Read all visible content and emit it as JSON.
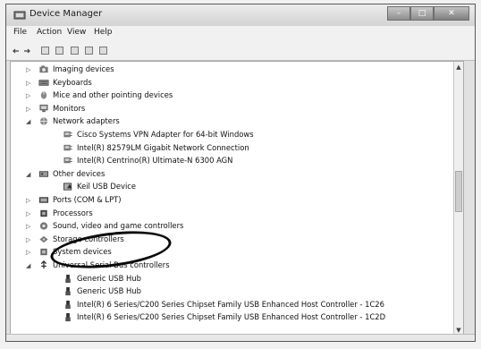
{
  "window": {
    "title": "Device Manager",
    "buttons": [
      "minimize",
      "maximize",
      "close"
    ]
  },
  "menu": {
    "items": [
      "File",
      "Action",
      "View",
      "Help"
    ]
  },
  "tree": {
    "rows": [
      {
        "label": "Imaging devices",
        "icon": "camera-icon",
        "expanded": false,
        "level": 0
      },
      {
        "label": "Keyboards",
        "icon": "keyboard-icon",
        "expanded": false,
        "level": 0
      },
      {
        "label": "Mice and other pointing devices",
        "icon": "mouse-icon",
        "expanded": false,
        "level": 0
      },
      {
        "label": "Monitors",
        "icon": "monitor-icon",
        "expanded": false,
        "level": 0
      },
      {
        "label": "Network adapters",
        "icon": "network-icon",
        "expanded": true,
        "level": 0
      },
      {
        "label": "Cisco Systems VPN Adapter for 64-bit Windows",
        "icon": "network-adapter-icon",
        "expanded": null,
        "level": 1
      },
      {
        "label": "Intel(R) 82579LM Gigabit Network Connection",
        "icon": "network-adapter-icon",
        "expanded": null,
        "level": 1
      },
      {
        "label": "Intel(R) Centrino(R) Ultimate-N 6300 AGN",
        "icon": "network-adapter-icon",
        "expanded": null,
        "level": 1
      },
      {
        "label": "Other devices",
        "icon": "other-devices-icon",
        "expanded": true,
        "level": 0
      },
      {
        "label": "Keil USB Device",
        "icon": "warning-device-icon",
        "expanded": null,
        "level": 1
      },
      {
        "label": "Ports (COM & LPT)",
        "icon": "port-icon",
        "expanded": false,
        "level": 0
      },
      {
        "label": "Processors",
        "icon": "processor-icon",
        "expanded": false,
        "level": 0
      },
      {
        "label": "Sound, video and game controllers",
        "icon": "sound-icon",
        "expanded": false,
        "level": 0
      },
      {
        "label": "Storage controllers",
        "icon": "storage-icon",
        "expanded": false,
        "level": 0
      },
      {
        "label": "System devices",
        "icon": "system-icon",
        "expanded": false,
        "level": 0
      },
      {
        "label": "Universal Serial Bus controllers",
        "icon": "usb-icon",
        "expanded": true,
        "level": 0
      },
      {
        "label": "Generic USB Hub",
        "icon": "usb-device-icon",
        "expanded": null,
        "level": 1
      },
      {
        "label": "Generic USB Hub",
        "icon": "usb-device-icon",
        "expanded": null,
        "level": 1
      },
      {
        "label": "Intel(R) 6 Series/C200 Series Chipset Family USB Enhanced Host Controller - 1C26",
        "icon": "usb-device-icon",
        "expanded": null,
        "level": 1
      },
      {
        "label": "Intel(R) 6 Series/C200 Series Chipset Family USB Enhanced Host Controller - 1C2D",
        "icon": "usb-device-icon",
        "expanded": null,
        "level": 1
      }
    ]
  }
}
